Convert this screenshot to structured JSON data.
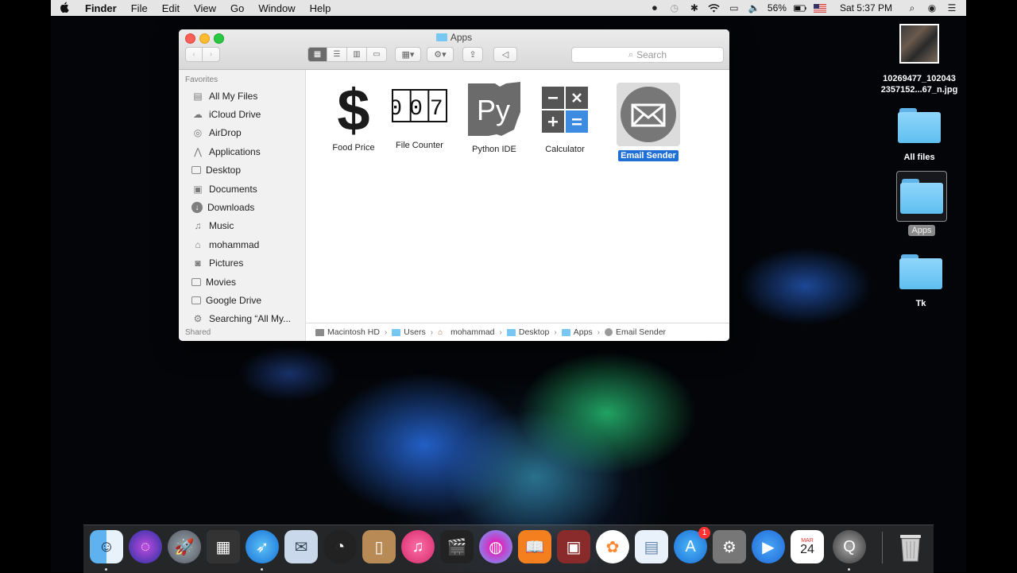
{
  "menubar": {
    "app_name": "Finder",
    "items": [
      "File",
      "Edit",
      "View",
      "Go",
      "Window",
      "Help"
    ],
    "battery": "56%",
    "clock": "Sat 5:37 PM"
  },
  "finder": {
    "title": "Apps",
    "search_placeholder": "Search",
    "sidebar": {
      "favorites_label": "Favorites",
      "items": [
        {
          "label": "All My Files",
          "icon": "all-files-icon"
        },
        {
          "label": "iCloud Drive",
          "icon": "cloud-icon"
        },
        {
          "label": "AirDrop",
          "icon": "airdrop-icon"
        },
        {
          "label": "Applications",
          "icon": "applications-icon"
        },
        {
          "label": "Desktop",
          "icon": "desktop-icon"
        },
        {
          "label": "Documents",
          "icon": "documents-icon"
        },
        {
          "label": "Downloads",
          "icon": "downloads-icon"
        },
        {
          "label": "Music",
          "icon": "music-icon"
        },
        {
          "label": "mohammad",
          "icon": "home-icon"
        },
        {
          "label": "Pictures",
          "icon": "camera-icon"
        },
        {
          "label": "Movies",
          "icon": "film-icon"
        },
        {
          "label": "Google Drive",
          "icon": "folder-icon"
        },
        {
          "label": "Searching “All My...",
          "icon": "gear-icon"
        }
      ],
      "shared_label": "Shared"
    },
    "files": [
      {
        "label": "Food Price",
        "icon": "dollar-icon"
      },
      {
        "label": "File Counter",
        "icon": "counter-icon",
        "counter": "007"
      },
      {
        "label": "Python IDE",
        "icon": "python-icon",
        "glyph": "Py"
      },
      {
        "label": "Calculator",
        "icon": "calculator-icon"
      },
      {
        "label": "Email Sender",
        "icon": "envelope-icon",
        "selected": true
      }
    ],
    "path": [
      "Macintosh HD",
      "Users",
      "mohammad",
      "Desktop",
      "Apps",
      "Email Sender"
    ]
  },
  "desktop_icons": [
    {
      "label_line1": "10269477_102043",
      "label_line2": "2357152...67_n.jpg",
      "icon": "photo-thumbnail"
    },
    {
      "label": "All files",
      "icon": "folder-icon"
    },
    {
      "label": "Apps",
      "icon": "folder-icon",
      "selected": true
    },
    {
      "label": "Tk",
      "icon": "folder-icon"
    }
  ],
  "dock": {
    "calendar_month": "MAR",
    "calendar_day": "24",
    "app_store_badge": "1"
  }
}
